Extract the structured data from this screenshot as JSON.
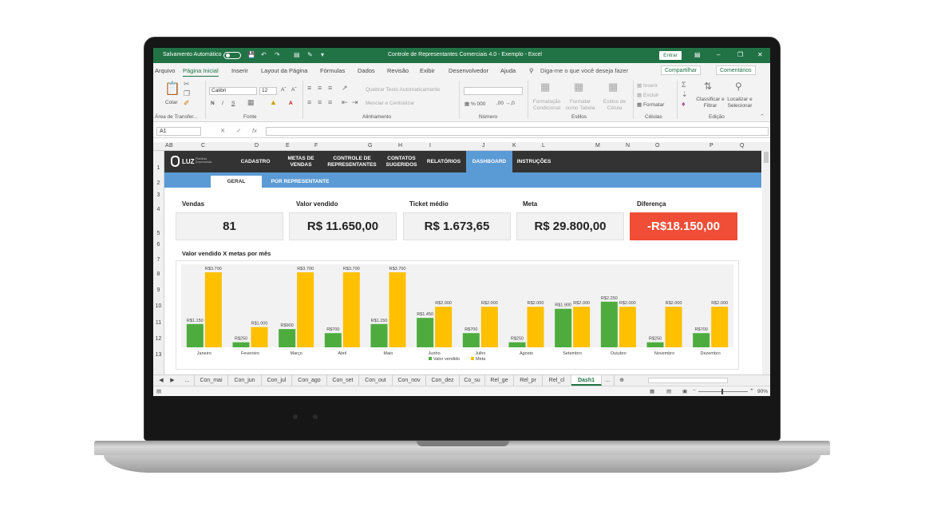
{
  "titlebar": {
    "autosave_label": "Salvamento Automático",
    "document_title": "Controle de Representantes Comerciais 4.0 - Exemplo  -  Excel",
    "enter_label": "Entrar"
  },
  "menu": {
    "items": [
      "Arquivo",
      "Página Inicial",
      "Inserir",
      "Layout da Página",
      "Fórmulas",
      "Dados",
      "Revisão",
      "Exibir",
      "Desenvolvedor",
      "Ajuda"
    ],
    "active_index": 1,
    "search_placeholder": "Diga-me o que você deseja fazer",
    "share_label": "Compartilhar",
    "comments_label": "Comentários"
  },
  "ribbon": {
    "paste_label": "Colar",
    "clipboard_group": "Área de Transfer...",
    "font_name": "Calibri",
    "font_size": "12",
    "font_group": "Fonte",
    "wrap_text": "Quebrar Texto Automaticamente",
    "merge_center": "Mesclar e Centralizar",
    "alignment_group": "Alinhamento",
    "number_group": "Número",
    "conditional_format": "Formatação Condicional",
    "format_as_table": "Formatar como Tabela",
    "cell_styles": "Estilos de Célula",
    "styles_group": "Estilos",
    "insert_label": "Inserir",
    "delete_label": "Excluir",
    "format_label": "Formatar",
    "cells_group": "Células",
    "sort_filter": "Classificar e Filtrar",
    "find_select": "Localizar e Selecionar",
    "editing_group": "Edição"
  },
  "formula_bar": {
    "name_box": "A1",
    "fx_label": "fx",
    "value": ""
  },
  "columns": [
    "A",
    "B",
    "C",
    "D",
    "E",
    "F",
    "G",
    "H",
    "I",
    "J",
    "K",
    "L",
    "M",
    "N",
    "O",
    "P",
    "Q"
  ],
  "rows": [
    "1",
    "2",
    "3",
    "4",
    "5",
    "6",
    "7",
    "8",
    "9",
    "10",
    "11",
    "12",
    "13"
  ],
  "navbar": {
    "logo_text": "LUZ",
    "logo_sub": "Planilhas Empresariais",
    "items": [
      "CADASTRO",
      "METAS DE VENDAS",
      "CONTROLE DE REPRESENTANTES",
      "CONTATOS SUGERIDOS",
      "RELATÓRIOS",
      "DASHBOARD",
      "INSTRUÇÕES"
    ],
    "active_index": 5
  },
  "subnav": {
    "tabs": [
      "GERAL",
      "POR REPRESENTANTE"
    ],
    "active_index": 0
  },
  "kpis": [
    {
      "label": "Vendas",
      "value": "81",
      "negative": false
    },
    {
      "label": "Valor vendido",
      "value": "R$ 11.650,00",
      "negative": false
    },
    {
      "label": "Ticket médio",
      "value": "R$ 1.673,65",
      "negative": false
    },
    {
      "label": "Meta",
      "value": "R$ 29.800,00",
      "negative": false
    },
    {
      "label": "Diferença",
      "value": "-R$18.150,00",
      "negative": true
    }
  ],
  "chart_data": {
    "type": "bar",
    "title": "Valor vendido X metas por mês",
    "categories": [
      "Janeiro",
      "Fevereiro",
      "Março",
      "Abril",
      "Maio",
      "Junho",
      "Julho",
      "Agosto",
      "Setembro",
      "Outubro",
      "Novembro",
      "Dezembro"
    ],
    "series": [
      {
        "name": "Valor vendido",
        "color": "#4eac3f",
        "values": [
          1150,
          250,
          900,
          700,
          1150,
          1450,
          700,
          250,
          1900,
          2250,
          250,
          700
        ],
        "labels": [
          "R$1.150",
          "R$250",
          "R$900",
          "R$700",
          "R$1.150",
          "R$1.450",
          "R$700",
          "R$250",
          "R$1.900",
          "R$2.250",
          "R$250",
          "R$700"
        ]
      },
      {
        "name": "Meta",
        "color": "#ffc000",
        "values": [
          3700,
          1000,
          3700,
          3700,
          3700,
          2000,
          2000,
          2000,
          2000,
          2000,
          2000,
          2000
        ],
        "labels": [
          "R$3.700",
          "R$1.000",
          "R$3.700",
          "R$3.700",
          "R$3.700",
          "R$2.000",
          "R$2.000",
          "R$2.000",
          "R$2.000",
          "R$2.000",
          "R$2.000",
          "R$2.000"
        ]
      }
    ],
    "ylim": [
      0,
      3700
    ],
    "grid": false,
    "legend_position": "bottom"
  },
  "sheet_tabs": {
    "items": [
      "...",
      "Con_mai",
      "Con_jun",
      "Con_jul",
      "Con_ago",
      "Con_set",
      "Con_out",
      "Con_nov",
      "Con_dez",
      "Co_su",
      "Rel_ge",
      "Rel_pr",
      "Rel_cl",
      "Dash1",
      "..."
    ],
    "active_index": 13
  },
  "status": {
    "zoom": "90%"
  }
}
